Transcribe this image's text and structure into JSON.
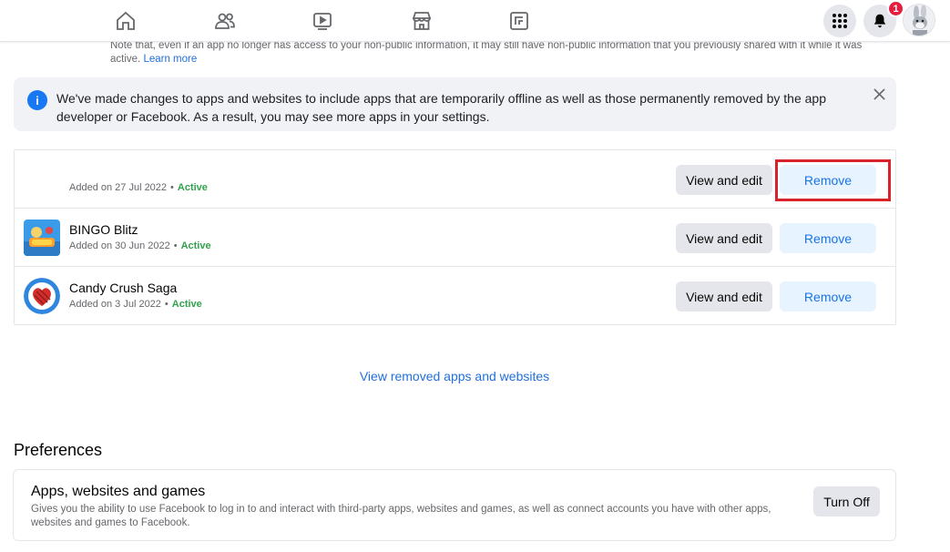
{
  "nav": {
    "icons": [
      "home-icon",
      "friends-icon",
      "watch-icon",
      "marketplace-icon",
      "gaming-icon"
    ],
    "notification_count": "1"
  },
  "note": {
    "text": "Note that, even if an app no longer has access to your non-public information, it may still have non-public information that you previously shared with it while it was active.",
    "link": "Learn more"
  },
  "banner": {
    "icon": "i",
    "text": "We've made changes to apps and websites to include apps that are temporarily offline as well as those permanently removed by the app developer or Facebook. As a result, you may see more apps in your settings."
  },
  "apps": [
    {
      "name": "",
      "added": "Added on 27 Jul 2022",
      "status": "Active",
      "view_label": "View and edit",
      "remove_label": "Remove"
    },
    {
      "name": "BINGO Blitz",
      "added": "Added on 30 Jun 2022",
      "status": "Active",
      "view_label": "View and edit",
      "remove_label": "Remove"
    },
    {
      "name": "Candy Crush Saga",
      "added": "Added on 3 Jul 2022",
      "status": "Active",
      "view_label": "View and edit",
      "remove_label": "Remove"
    }
  ],
  "removed_link": "View removed apps and websites",
  "preferences": {
    "title": "Preferences",
    "item_name": "Apps, websites and games",
    "item_desc": "Gives you the ability to use Facebook to log in to and interact with third-party apps, websites and games, as well as connect accounts you have with other apps, websites and games to Facebook.",
    "button": "Turn Off"
  },
  "colors": {
    "accent": "#1877f2",
    "active": "#31a24c",
    "highlight": "#d8232a"
  }
}
